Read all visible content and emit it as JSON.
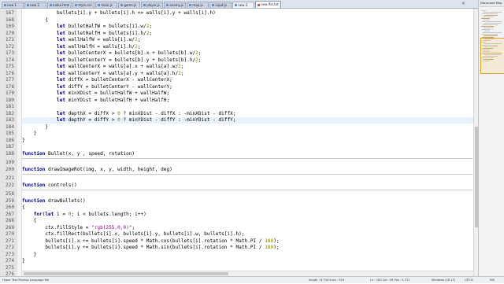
{
  "tabs": [
    {
      "label": "new 1",
      "state": "normal"
    },
    {
      "label": "new 2",
      "state": "normal"
    },
    {
      "label": "index.html",
      "state": "normal"
    },
    {
      "label": "style.css",
      "state": "normal"
    },
    {
      "label": "main.js",
      "state": "normal"
    },
    {
      "label": "game.js",
      "state": "normal"
    },
    {
      "label": "player.js",
      "state": "normal"
    },
    {
      "label": "enemy.js",
      "state": "normal"
    },
    {
      "label": "map.js",
      "state": "normal"
    },
    {
      "label": "input.js",
      "state": "normal"
    },
    {
      "label": "new 3",
      "state": "plain"
    },
    {
      "label": "new file.txt",
      "state": "active"
    }
  ],
  "tab_close_glyph": "×",
  "side_panel": {
    "title": "Document Map"
  },
  "editor": {
    "lines": [
      {
        "n": "167",
        "t": [
          [
            "",
            "            bullets[i].y + bullets[i].h <= walls[i].y + walls[i].h)"
          ]
        ]
      },
      {
        "n": "168",
        "t": [
          [
            "",
            "        {"
          ]
        ]
      },
      {
        "n": "169",
        "t": [
          [
            "",
            "            "
          ],
          [
            "kw",
            "let"
          ],
          [
            "",
            " bulletHalfW = bullets[i].w/"
          ],
          [
            "num",
            "2"
          ],
          [
            "",
            ";"
          ]
        ]
      },
      {
        "n": "170",
        "t": [
          [
            "",
            "            "
          ],
          [
            "kw",
            "let"
          ],
          [
            "",
            " bulletHalfH = bullets[i].h/"
          ],
          [
            "num",
            "2"
          ],
          [
            "",
            ";"
          ]
        ]
      },
      {
        "n": "171",
        "t": [
          [
            "",
            "            "
          ],
          [
            "kw",
            "let"
          ],
          [
            "",
            " wallHalfW = walls[i].w/"
          ],
          [
            "num",
            "2"
          ],
          [
            "",
            ";"
          ]
        ]
      },
      {
        "n": "172",
        "t": [
          [
            "",
            "            "
          ],
          [
            "kw",
            "let"
          ],
          [
            "",
            " wallHalfH = walls[i].h/"
          ],
          [
            "num",
            "2"
          ],
          [
            "",
            ";"
          ]
        ]
      },
      {
        "n": "173",
        "t": [
          [
            "",
            "            "
          ],
          [
            "kw",
            "let"
          ],
          [
            "",
            " bulletCenterX = bullets[b].x + bullets[b].w/"
          ],
          [
            "num",
            "2"
          ],
          [
            "",
            ";"
          ]
        ]
      },
      {
        "n": "174",
        "t": [
          [
            "",
            "            "
          ],
          [
            "kw",
            "let"
          ],
          [
            "",
            " bulletCenterY = bullets[b].y + bullets[b].h/"
          ],
          [
            "num",
            "2"
          ],
          [
            "",
            ";"
          ]
        ]
      },
      {
        "n": "175",
        "t": [
          [
            "",
            "            "
          ],
          [
            "kw",
            "let"
          ],
          [
            "",
            " wallCenterX = walls[a].x + walls[a].w/"
          ],
          [
            "num",
            "2"
          ],
          [
            "",
            ";"
          ]
        ]
      },
      {
        "n": "176",
        "t": [
          [
            "",
            "            "
          ],
          [
            "kw",
            "let"
          ],
          [
            "",
            " wallCenterY = walls[a].y + walls[a].h/"
          ],
          [
            "num",
            "2"
          ],
          [
            "",
            ";"
          ]
        ]
      },
      {
        "n": "177",
        "t": [
          [
            "",
            "            "
          ],
          [
            "kw",
            "let"
          ],
          [
            "",
            " diffX = bulletCenterX - wallCenterX;"
          ]
        ]
      },
      {
        "n": "178",
        "t": [
          [
            "",
            "            "
          ],
          [
            "kw",
            "let"
          ],
          [
            "",
            " diffY = bulletCenterY - wallCenterY;"
          ]
        ]
      },
      {
        "n": "179",
        "t": [
          [
            "",
            "            "
          ],
          [
            "kw",
            "let"
          ],
          [
            "",
            " minXDist = bulletHalfW + wallHalfW;"
          ]
        ]
      },
      {
        "n": "180",
        "t": [
          [
            "",
            "            "
          ],
          [
            "kw",
            "let"
          ],
          [
            "",
            " minYDist = bulletHalfH + wallHalfH;"
          ]
        ]
      },
      {
        "n": "181",
        "t": [
          [
            "",
            ""
          ]
        ]
      },
      {
        "n": "182",
        "t": [
          [
            "",
            "            "
          ],
          [
            "kw",
            "let"
          ],
          [
            "",
            " depthX = diffX > "
          ],
          [
            "num",
            "0"
          ],
          [
            "",
            " ? minXDist - diffX : -minXDist - diffX;"
          ]
        ]
      },
      {
        "n": "183",
        "t": [
          [
            "",
            "            "
          ],
          [
            "kw",
            "let"
          ],
          [
            "",
            " depthY = diffY > "
          ],
          [
            "num",
            "0"
          ],
          [
            "",
            " ? minYDist - diffY : -minYDist - diffY;"
          ]
        ],
        "current": true
      },
      {
        "n": "184",
        "t": [
          [
            "",
            "        }"
          ]
        ]
      },
      {
        "n": "185",
        "t": [
          [
            "",
            "    }"
          ]
        ]
      },
      {
        "n": "186",
        "t": [
          [
            "",
            "}"
          ]
        ]
      },
      {
        "n": "187",
        "t": [
          [
            "",
            ""
          ]
        ]
      },
      {
        "n": "188",
        "t": [
          [
            "kw",
            "function"
          ],
          [
            "",
            " Bullet(x, y , speed, rotation)"
          ]
        ],
        "sep_after": true
      },
      {
        "n": "199",
        "t": [
          [
            "",
            ""
          ]
        ]
      },
      {
        "n": "200",
        "t": [
          [
            "kw",
            "function"
          ],
          [
            "",
            " drawImageRot(img, x, y, width, height, deg)"
          ]
        ],
        "sep_after": true
      },
      {
        "n": "221",
        "t": [
          [
            "",
            ""
          ]
        ]
      },
      {
        "n": "222",
        "t": [
          [
            "kw",
            "function"
          ],
          [
            "",
            " controls()"
          ]
        ],
        "sep_after": true
      },
      {
        "n": "258",
        "t": [
          [
            "",
            ""
          ]
        ]
      },
      {
        "n": "259",
        "t": [
          [
            "kw",
            "function"
          ],
          [
            "",
            " drawBullets()"
          ]
        ]
      },
      {
        "n": "260",
        "t": [
          [
            "",
            "{"
          ]
        ]
      },
      {
        "n": "267",
        "t": [
          [
            "",
            "    "
          ],
          [
            "kw",
            "for"
          ],
          [
            "",
            "("
          ],
          [
            "kw",
            "let"
          ],
          [
            "",
            " i = "
          ],
          [
            "num",
            "0"
          ],
          [
            "",
            "; i < bullets.length; i++)"
          ]
        ]
      },
      {
        "n": "268",
        "t": [
          [
            "",
            "    {"
          ]
        ]
      },
      {
        "n": "269",
        "t": [
          [
            "",
            "        ctx.fillStyle = "
          ],
          [
            "str",
            "\"rgb(255,0,0)\""
          ],
          [
            "",
            ";"
          ]
        ]
      },
      {
        "n": "270",
        "t": [
          [
            "",
            "        ctx.fillRect(bullets[i].x, bullets[i].y, bullets[i].w, bullets[i].h);"
          ]
        ]
      },
      {
        "n": "271",
        "t": [
          [
            "",
            "        bullets[i].x += bullets[i].speed * Math.cos(bullets[i].rotation * Math.PI / "
          ],
          [
            "num",
            "180"
          ],
          [
            "",
            ");"
          ]
        ]
      },
      {
        "n": "272",
        "t": [
          [
            "",
            "        bullets[i].y += bullets[i].speed * Math.sin(bullets[i].rotation * Math.PI / "
          ],
          [
            "num",
            "180"
          ],
          [
            "",
            ");"
          ]
        ]
      },
      {
        "n": "273",
        "t": [
          [
            "",
            "    }"
          ]
        ]
      },
      {
        "n": "274",
        "t": [
          [
            "",
            "}"
          ]
        ]
      },
      {
        "n": "275",
        "t": [
          [
            "",
            ""
          ]
        ]
      },
      {
        "n": "276",
        "t": [
          [
            "kw",
            "function"
          ],
          [
            "",
            " Player(x, y, sp, r, h)"
          ]
        ]
      }
    ]
  },
  "status": {
    "left": "Hyper Text Markup Language file",
    "length": "length : 6,744    lines : 316",
    "pos": "Ln : 183    Col : 58    Pos : 5,717",
    "eol": "Windows (CR LF)",
    "enc": "UTF-8",
    "ins": "INS"
  }
}
